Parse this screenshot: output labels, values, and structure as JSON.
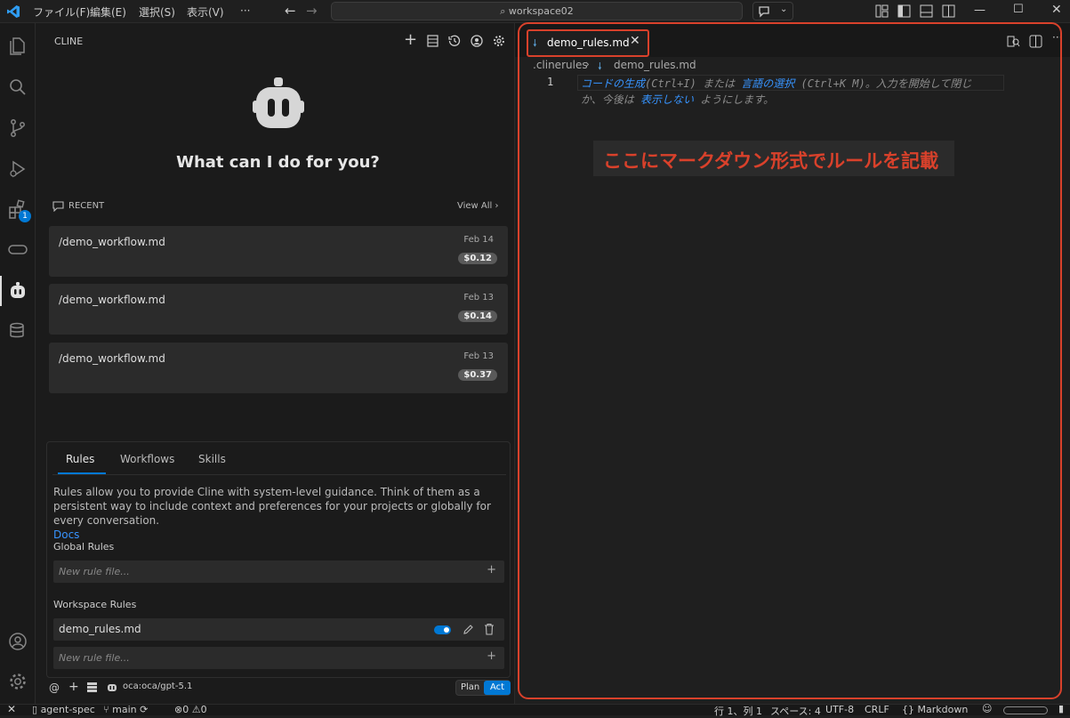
{
  "titlebar": {
    "menus": [
      "ファイル(F)",
      "編集(E)",
      "選択(S)",
      "表示(V)",
      "···"
    ],
    "search": "workspace02"
  },
  "sidebar": {
    "title": "CLINE",
    "heading": "What can I do for you?",
    "recent_label": "RECENT",
    "view_all": "View All",
    "tasks": [
      {
        "name": "/demo_workflow.md",
        "date": "Feb 14",
        "cost": "$0.12"
      },
      {
        "name": "/demo_workflow.md",
        "date": "Feb 13",
        "cost": "$0.14"
      },
      {
        "name": "/demo_workflow.md",
        "date": "Feb 13",
        "cost": "$0.37"
      }
    ],
    "rules": {
      "tabs": [
        "Rules",
        "Workflows",
        "Skills"
      ],
      "desc": "Rules allow you to provide Cline with system-level guidance. Think of them as a persistent way to include context and preferences for your projects or globally for every conversation.",
      "docs": "Docs",
      "global_label": "Global Rules",
      "new_placeholder": "New rule file...",
      "workspace_label": "Workspace Rules",
      "workspace_file": "demo_rules.md",
      "toggle_on": true
    },
    "footer": {
      "model": "oca:oca/gpt-5.1",
      "plan": "Plan",
      "act": "Act"
    }
  },
  "editor": {
    "tab": "demo_rules.md",
    "breadcrumb": [
      ".clinerules",
      "demo_rules.md"
    ],
    "line_number": "1",
    "hint": {
      "p1": "コードの生成",
      "p2": "(Ctrl+I) または ",
      "p3": "言語の選択",
      "p4": " (Ctrl+K M)。入力を開始して閉じ",
      "p5": "か、今後は ",
      "p6": "表示しない",
      "p7": " ようにします。"
    },
    "annotation": "ここにマークダウン形式でルールを記載"
  },
  "statusbar": {
    "branch_left": "agent-spec",
    "branch": "main",
    "problems": "0",
    "warnings": "0",
    "position": "行 1、列 1",
    "spaces": "スペース: 4",
    "encoding": "UTF-8",
    "eol": "CRLF",
    "language": "Markdown"
  },
  "colors": {
    "accent": "#0078d4",
    "annotation_red": "#d9412b",
    "link": "#3794ff"
  }
}
